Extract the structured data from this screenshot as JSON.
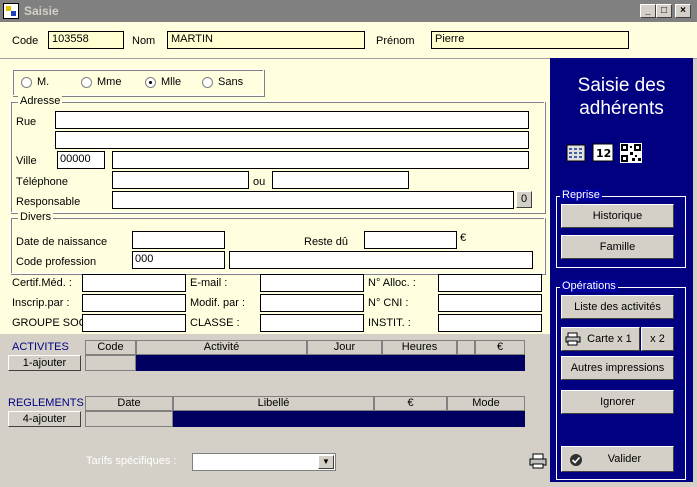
{
  "window": {
    "title": "Saisie",
    "controls": [
      "_",
      "□",
      "×"
    ]
  },
  "header": {
    "code_label": "Code",
    "code_value": "103558",
    "nom_label": "Nom",
    "nom_value": "MARTIN",
    "prenom_label": "Prénom",
    "prenom_value": "Pierre"
  },
  "civility": {
    "options": [
      "M.",
      "Mme",
      "Mlle",
      "Sans"
    ],
    "selected": "Mlle"
  },
  "adresse": {
    "legend": "Adresse",
    "rue_label": "Rue",
    "ville_label": "Ville",
    "cp_value": "00000",
    "telephone_label": "Téléphone",
    "ou_label": "ou",
    "responsable_label": "Responsable",
    "responsable_btn": "0"
  },
  "divers": {
    "legend": "Divers",
    "naissance_label": "Date de naissance",
    "reste_label": "Reste dû",
    "euro": "€",
    "profession_label": "Code profession",
    "profession_value": "000"
  },
  "extra": {
    "certif_label": "Certif.Méd. :",
    "email_label": "E-mail :",
    "alloc_label": "N° Alloc. :",
    "inscrip_label": "Inscrip.par :",
    "modif_label": "Modif. par :",
    "cni_label": "N° CNI :",
    "groupe_label": "GROUPE SOCI",
    "classe_label": "CLASSE :",
    "instit_label": "INSTIT. :"
  },
  "activites": {
    "title": "ACTIVITES",
    "add_button": "1-ajouter",
    "columns": [
      "Code",
      "Activité",
      "Jour",
      "Heures",
      "",
      "€"
    ]
  },
  "reglements": {
    "title": "REGLEMENTS",
    "add_button": "4-ajouter",
    "columns": [
      "Date",
      "Libellé",
      "€",
      "Mode"
    ]
  },
  "tarifs": {
    "label": "Tarifs spécifiques :",
    "selected": ""
  },
  "panel": {
    "title_line1": "Saisie des",
    "title_line2": "adhérents",
    "icons": [
      "calculator-icon",
      "numbering-icon",
      "qr-code-icon"
    ],
    "reprise_legend": "Reprise",
    "historique_btn": "Historique",
    "famille_btn": "Famille",
    "operations_legend": "Opérations",
    "liste_btn": "Liste des activités",
    "carte_btn": "Carte x 1",
    "x2_btn": "x 2",
    "autres_btn": "Autres impressions",
    "ignorer_btn": "Ignorer",
    "valider_btn": "Valider"
  },
  "colors": {
    "titlebar": "#808080",
    "panel": "#000080",
    "form_bg": "#ffffe0",
    "grid_row": "#000060"
  }
}
